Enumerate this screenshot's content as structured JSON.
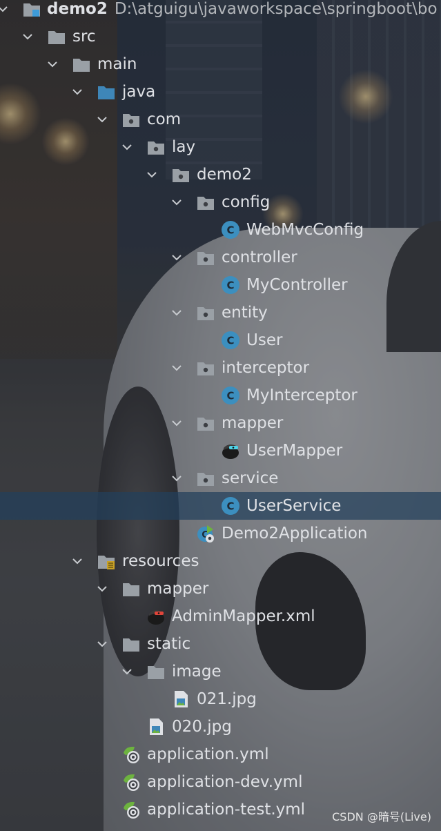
{
  "project": {
    "name": "demo2",
    "path": "D:\\atguigu\\javaworkspace\\springboot\\bo"
  },
  "tree": [
    {
      "label": "src",
      "icon": "folder-icon",
      "expanded": true
    },
    {
      "label": "main",
      "icon": "folder-icon",
      "expanded": true
    },
    {
      "label": "java",
      "icon": "source-folder-icon",
      "expanded": true
    },
    {
      "label": "com",
      "icon": "package-icon",
      "expanded": true
    },
    {
      "label": "lay",
      "icon": "package-icon",
      "expanded": true
    },
    {
      "label": "demo2",
      "icon": "package-icon",
      "expanded": true
    },
    {
      "label": "config",
      "icon": "package-icon",
      "expanded": true
    },
    {
      "label": "WebMvcConfig",
      "icon": "class-icon"
    },
    {
      "label": "controller",
      "icon": "package-icon",
      "expanded": true
    },
    {
      "label": "MyController",
      "icon": "class-icon"
    },
    {
      "label": "entity",
      "icon": "package-icon",
      "expanded": true
    },
    {
      "label": "User",
      "icon": "class-icon"
    },
    {
      "label": "interceptor",
      "icon": "package-icon",
      "expanded": true
    },
    {
      "label": "MyInterceptor",
      "icon": "class-icon"
    },
    {
      "label": "mapper",
      "icon": "package-icon",
      "expanded": true
    },
    {
      "label": "UserMapper",
      "icon": "mybatis-icon"
    },
    {
      "label": "service",
      "icon": "package-icon",
      "expanded": true
    },
    {
      "label": "UserService",
      "icon": "class-icon",
      "selected": true
    },
    {
      "label": "Demo2Application",
      "icon": "spring-boot-app-icon"
    },
    {
      "label": "resources",
      "icon": "resources-folder-icon",
      "expanded": true
    },
    {
      "label": "mapper",
      "icon": "folder-icon",
      "expanded": true
    },
    {
      "label": "AdminMapper.xml",
      "icon": "mybatis-xml-icon"
    },
    {
      "label": "static",
      "icon": "folder-icon",
      "expanded": true
    },
    {
      "label": "image",
      "icon": "folder-icon",
      "expanded": true
    },
    {
      "label": "021.jpg",
      "icon": "image-file-icon"
    },
    {
      "label": "020.jpg",
      "icon": "image-file-icon"
    },
    {
      "label": "application.yml",
      "icon": "spring-yml-icon"
    },
    {
      "label": "application-dev.yml",
      "icon": "spring-yml-icon"
    },
    {
      "label": "application-test.yml",
      "icon": "spring-yml-icon"
    }
  ],
  "watermark": "CSDN @暗号(Live)",
  "colors": {
    "text": "#dfe1e5",
    "selection": "#22405c",
    "class_icon": "#3c8fbf",
    "folder": "#9aa0a6",
    "source_folder": "#3e86b8",
    "spring": "#6db33f"
  }
}
